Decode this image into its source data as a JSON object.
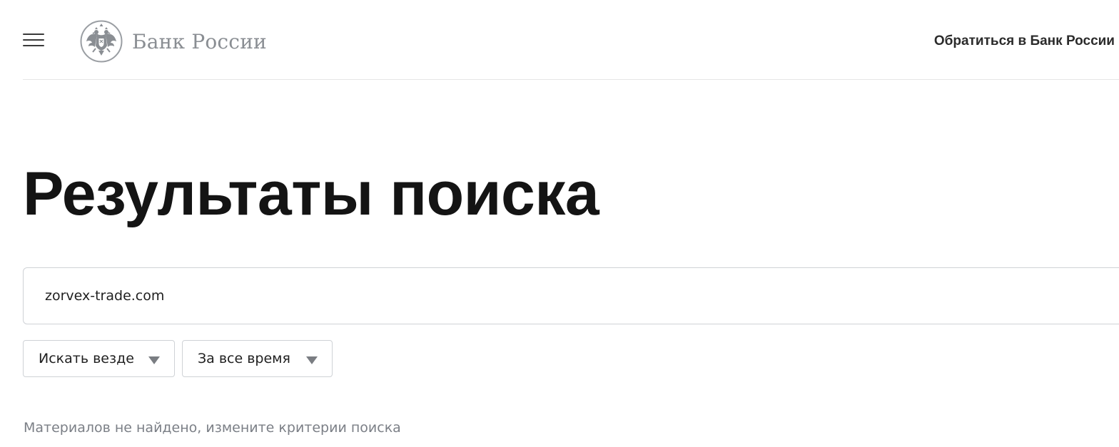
{
  "header": {
    "menu_icon": "hamburger-menu-icon",
    "logo": {
      "emblem_icon": "double-headed-eagle-emblem",
      "text": "Банк России"
    },
    "contact_link": "Обратиться в Банк России"
  },
  "main": {
    "title": "Результаты поиска",
    "search": {
      "value": "zorvex-trade.com",
      "placeholder": ""
    },
    "filters": {
      "scope": {
        "selected": "Искать везде",
        "icon": "caret-down-icon"
      },
      "period": {
        "selected": "За все время",
        "icon": "caret-down-icon"
      }
    },
    "empty_message": "Материалов не найдено, измените критерии поиска"
  },
  "colors": {
    "text_primary": "#141414",
    "text_muted": "#7b7f86",
    "logo_gray": "#8a8e93",
    "border": "#cfd2d6",
    "divider": "#e6e6e6",
    "background": "#ffffff"
  }
}
